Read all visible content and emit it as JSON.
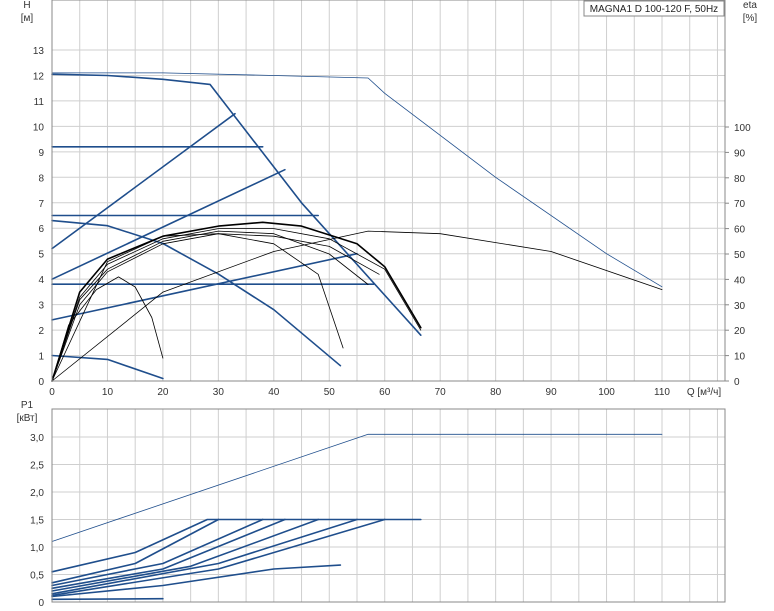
{
  "model_label": "MAGNA1 D 100-120 F, 50Hz",
  "colors": {
    "blue": "#1f4e8c",
    "black": "#000000",
    "grid": "#cfcfcf",
    "axis": "#888888"
  },
  "chart_data": [
    {
      "type": "line",
      "y_axis_title": "H",
      "y_axis_unit": "[м]",
      "right_axis_title": "eta",
      "right_axis_unit": "[%]",
      "x_axis_title": "Q [м³/ч]",
      "x_ticks": [
        "0",
        "10",
        "20",
        "30",
        "40",
        "50",
        "60",
        "70",
        "80",
        "90",
        "100",
        "110"
      ],
      "y_ticks": [
        "0",
        "1",
        "2",
        "3",
        "4",
        "5",
        "6",
        "7",
        "8",
        "9",
        "10",
        "11",
        "12",
        "13"
      ],
      "right_ticks": [
        "0",
        "10",
        "20",
        "30",
        "40",
        "50",
        "60",
        "70",
        "80",
        "90",
        "100"
      ],
      "xlim": [
        0,
        120
      ],
      "ylim": [
        0,
        14
      ],
      "right_ylim": [
        0,
        140
      ],
      "grid": true,
      "head_series": [
        {
          "style": "thick",
          "points": [
            [
              0,
              12.05
            ],
            [
              10,
              12.0
            ],
            [
              20,
              11.85
            ],
            [
              28.5,
              11.65
            ],
            [
              45,
              7.0
            ],
            [
              66.5,
              1.8
            ]
          ]
        },
        {
          "style": "thin",
          "points": [
            [
              0,
              12.1
            ],
            [
              20,
              12.1
            ],
            [
              40,
              12.0
            ],
            [
              57,
              11.9
            ],
            [
              60,
              11.3
            ],
            [
              80,
              8.0
            ],
            [
              100,
              5.0
            ],
            [
              110,
              3.7
            ]
          ]
        },
        {
          "style": "thick",
          "points": [
            [
              0,
              9.2
            ],
            [
              38,
              9.2
            ]
          ]
        },
        {
          "style": "thick",
          "points": [
            [
              0,
              6.5
            ],
            [
              48,
              6.5
            ]
          ]
        },
        {
          "style": "thick",
          "points": [
            [
              0,
              3.8
            ],
            [
              58,
              3.8
            ]
          ]
        },
        {
          "style": "thick",
          "points": [
            [
              0,
              5.2
            ],
            [
              33,
              10.5
            ]
          ]
        },
        {
          "style": "thick",
          "points": [
            [
              0,
              4.0
            ],
            [
              42,
              8.3
            ]
          ]
        },
        {
          "style": "thick",
          "points": [
            [
              0,
              2.4
            ],
            [
              55,
              5.0
            ]
          ]
        },
        {
          "style": "thick",
          "points": [
            [
              0,
              6.3
            ],
            [
              10,
              6.1
            ],
            [
              20,
              5.4
            ],
            [
              30,
              4.2
            ],
            [
              40,
              2.8
            ],
            [
              52,
              0.6
            ]
          ]
        },
        {
          "style": "thick",
          "points": [
            [
              0,
              1.0
            ],
            [
              10,
              0.85
            ],
            [
              20,
              0.1
            ]
          ]
        }
      ],
      "efficiency_series": [
        {
          "style": "thick",
          "points": [
            [
              0,
              0
            ],
            [
              5,
              35
            ],
            [
              10,
              48
            ],
            [
              20,
              57
            ],
            [
              30,
              61
            ],
            [
              38,
              62.5
            ],
            [
              45,
              61
            ],
            [
              55,
              54
            ],
            [
              60,
              45
            ],
            [
              66.5,
              21
            ]
          ]
        },
        {
          "style": "thin",
          "points": [
            [
              0,
              0
            ],
            [
              5,
              33
            ],
            [
              10,
              46
            ],
            [
              20,
              56
            ],
            [
              30,
              60
            ],
            [
              40,
              60
            ],
            [
              50,
              56
            ],
            [
              60,
              44
            ],
            [
              66.5,
              20
            ]
          ]
        },
        {
          "style": "thin",
          "points": [
            [
              0,
              0
            ],
            [
              5,
              32
            ],
            [
              10,
              44
            ],
            [
              20,
              55
            ],
            [
              30,
              59
            ],
            [
              40,
              58
            ],
            [
              50,
              50
            ],
            [
              57,
              38
            ]
          ]
        },
        {
          "style": "thin",
          "points": [
            [
              0,
              0
            ],
            [
              5,
              30
            ],
            [
              10,
              43
            ],
            [
              20,
              54
            ],
            [
              30,
              58
            ],
            [
              40,
              54
            ],
            [
              48,
              42
            ],
            [
              52.5,
              13
            ]
          ]
        },
        {
          "style": "thin",
          "points": [
            [
              0,
              0
            ],
            [
              3,
              22
            ],
            [
              8,
              36
            ],
            [
              12,
              41
            ],
            [
              15,
              37
            ],
            [
              18,
              25
            ],
            [
              20,
              9
            ]
          ]
        },
        {
          "style": "thin",
          "points": [
            [
              0,
              0
            ],
            [
              20,
              35
            ],
            [
              40,
              51
            ],
            [
              57,
              59
            ],
            [
              70,
              58
            ],
            [
              90,
              51
            ],
            [
              110,
              36
            ]
          ]
        },
        {
          "style": "thin",
          "points": [
            [
              0,
              0
            ],
            [
              10,
              47
            ],
            [
              20,
              57
            ],
            [
              30,
              58
            ],
            [
              40,
              57
            ],
            [
              50,
              53
            ],
            [
              59,
              42
            ]
          ]
        }
      ]
    },
    {
      "type": "line",
      "y_axis_title": "P1",
      "y_axis_unit": "[кВт]",
      "y_ticks": [
        "0",
        "0,5",
        "1,0",
        "1,5",
        "2,0",
        "2,5",
        "3,0"
      ],
      "xlim": [
        0,
        120
      ],
      "ylim": [
        0,
        3.0
      ],
      "grid": true,
      "power_series": [
        {
          "style": "thin",
          "points": [
            [
              0,
              1.1
            ],
            [
              57,
              3.05
            ],
            [
              110,
              3.05
            ]
          ]
        },
        {
          "style": "thick",
          "points": [
            [
              0,
              0.55
            ],
            [
              15,
              0.9
            ],
            [
              28,
              1.5
            ],
            [
              66.5,
              1.5
            ]
          ]
        },
        {
          "style": "thick",
          "points": [
            [
              0,
              0.35
            ],
            [
              15,
              0.7
            ],
            [
              30,
              1.5
            ]
          ]
        },
        {
          "style": "thick",
          "points": [
            [
              0,
              0.3
            ],
            [
              20,
              0.7
            ],
            [
              38,
              1.5
            ]
          ]
        },
        {
          "style": "thick",
          "points": [
            [
              0,
              0.25
            ],
            [
              20,
              0.6
            ],
            [
              42,
              1.5
            ]
          ]
        },
        {
          "style": "thick",
          "points": [
            [
              0,
              0.2
            ],
            [
              25,
              0.65
            ],
            [
              48,
              1.5
            ]
          ]
        },
        {
          "style": "thick",
          "points": [
            [
              0,
              0.15
            ],
            [
              30,
              0.7
            ],
            [
              55,
              1.5
            ]
          ]
        },
        {
          "style": "thick",
          "points": [
            [
              0,
              0.12
            ],
            [
              30,
              0.6
            ],
            [
              60,
              1.5
            ]
          ]
        },
        {
          "style": "thick",
          "points": [
            [
              0,
              0.1
            ],
            [
              20,
              0.3
            ],
            [
              40,
              0.6
            ],
            [
              52,
              0.67
            ]
          ]
        },
        {
          "style": "thick",
          "points": [
            [
              0,
              0.05
            ],
            [
              20,
              0.06
            ]
          ]
        }
      ]
    }
  ]
}
